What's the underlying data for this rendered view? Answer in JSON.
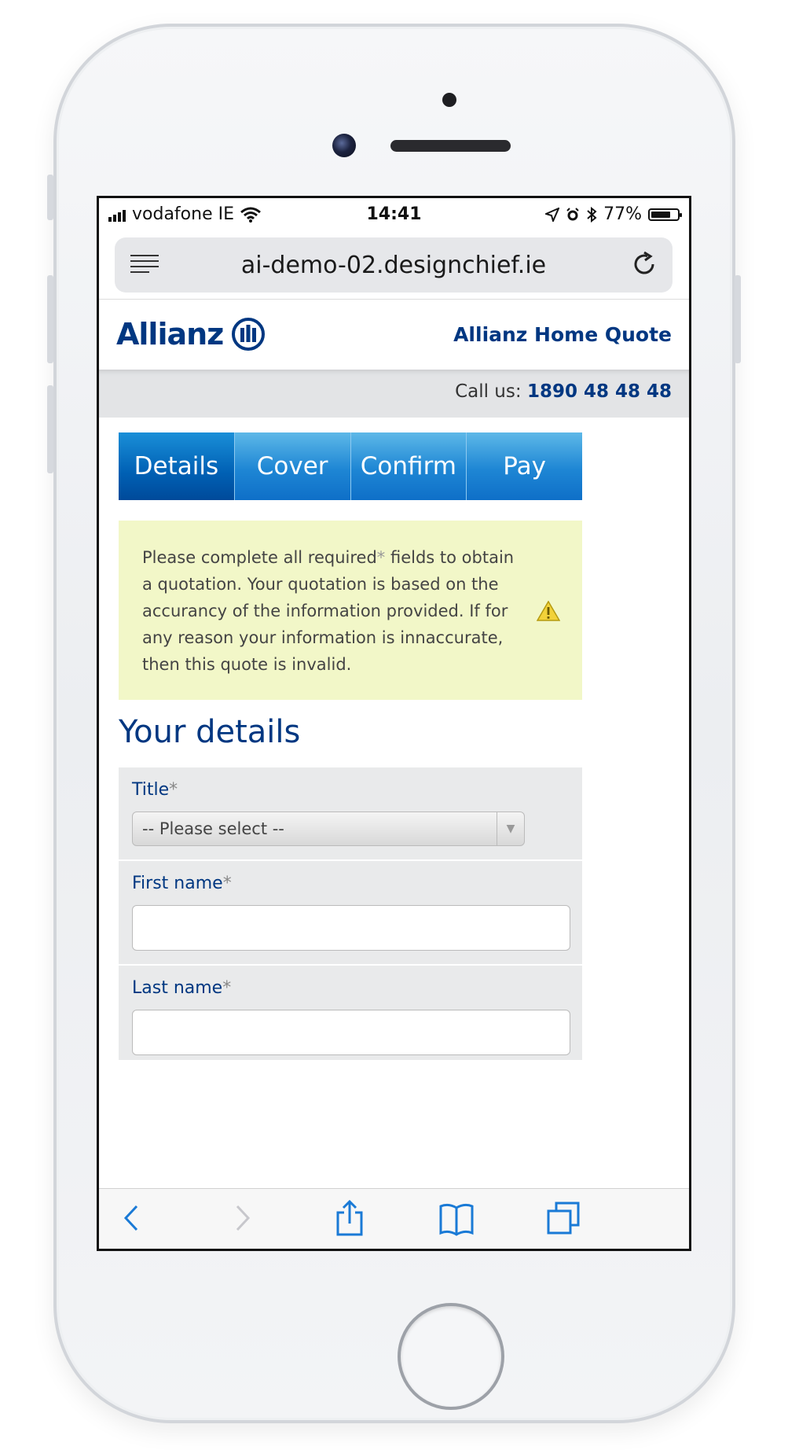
{
  "status_bar": {
    "carrier": "vodafone IE",
    "time": "14:41",
    "battery": "77%",
    "battery_level": 0.77
  },
  "browser": {
    "url": "ai-demo-02.designchief.ie"
  },
  "site": {
    "logo_text": "Allianz",
    "header_title": "Allianz Home Quote",
    "call_label": "Call us:",
    "call_number": "1890 48 48 48"
  },
  "tabs": [
    {
      "label": "Details",
      "active": true
    },
    {
      "label": "Cover",
      "active": false
    },
    {
      "label": "Confirm",
      "active": false
    },
    {
      "label": "Pay",
      "active": false
    }
  ],
  "notice": {
    "text_a": "Please complete all required",
    "star": "*",
    "text_b": " fields to obtain a quotation. Your quotation is based on the accurancy of the information provided. If for any reason your information is innaccurate, then this quote is invalid."
  },
  "form": {
    "section_title": "Your details",
    "title_label": "Title",
    "title_value": "-- Please select --",
    "first_name_label": "First name",
    "last_name_label": "Last name",
    "required_marker": "*"
  },
  "colors": {
    "brand": "#003781",
    "tab_blue": "#1e86d4",
    "notice_bg": "#f2f7c8",
    "ios_blue": "#1a7ad6"
  }
}
